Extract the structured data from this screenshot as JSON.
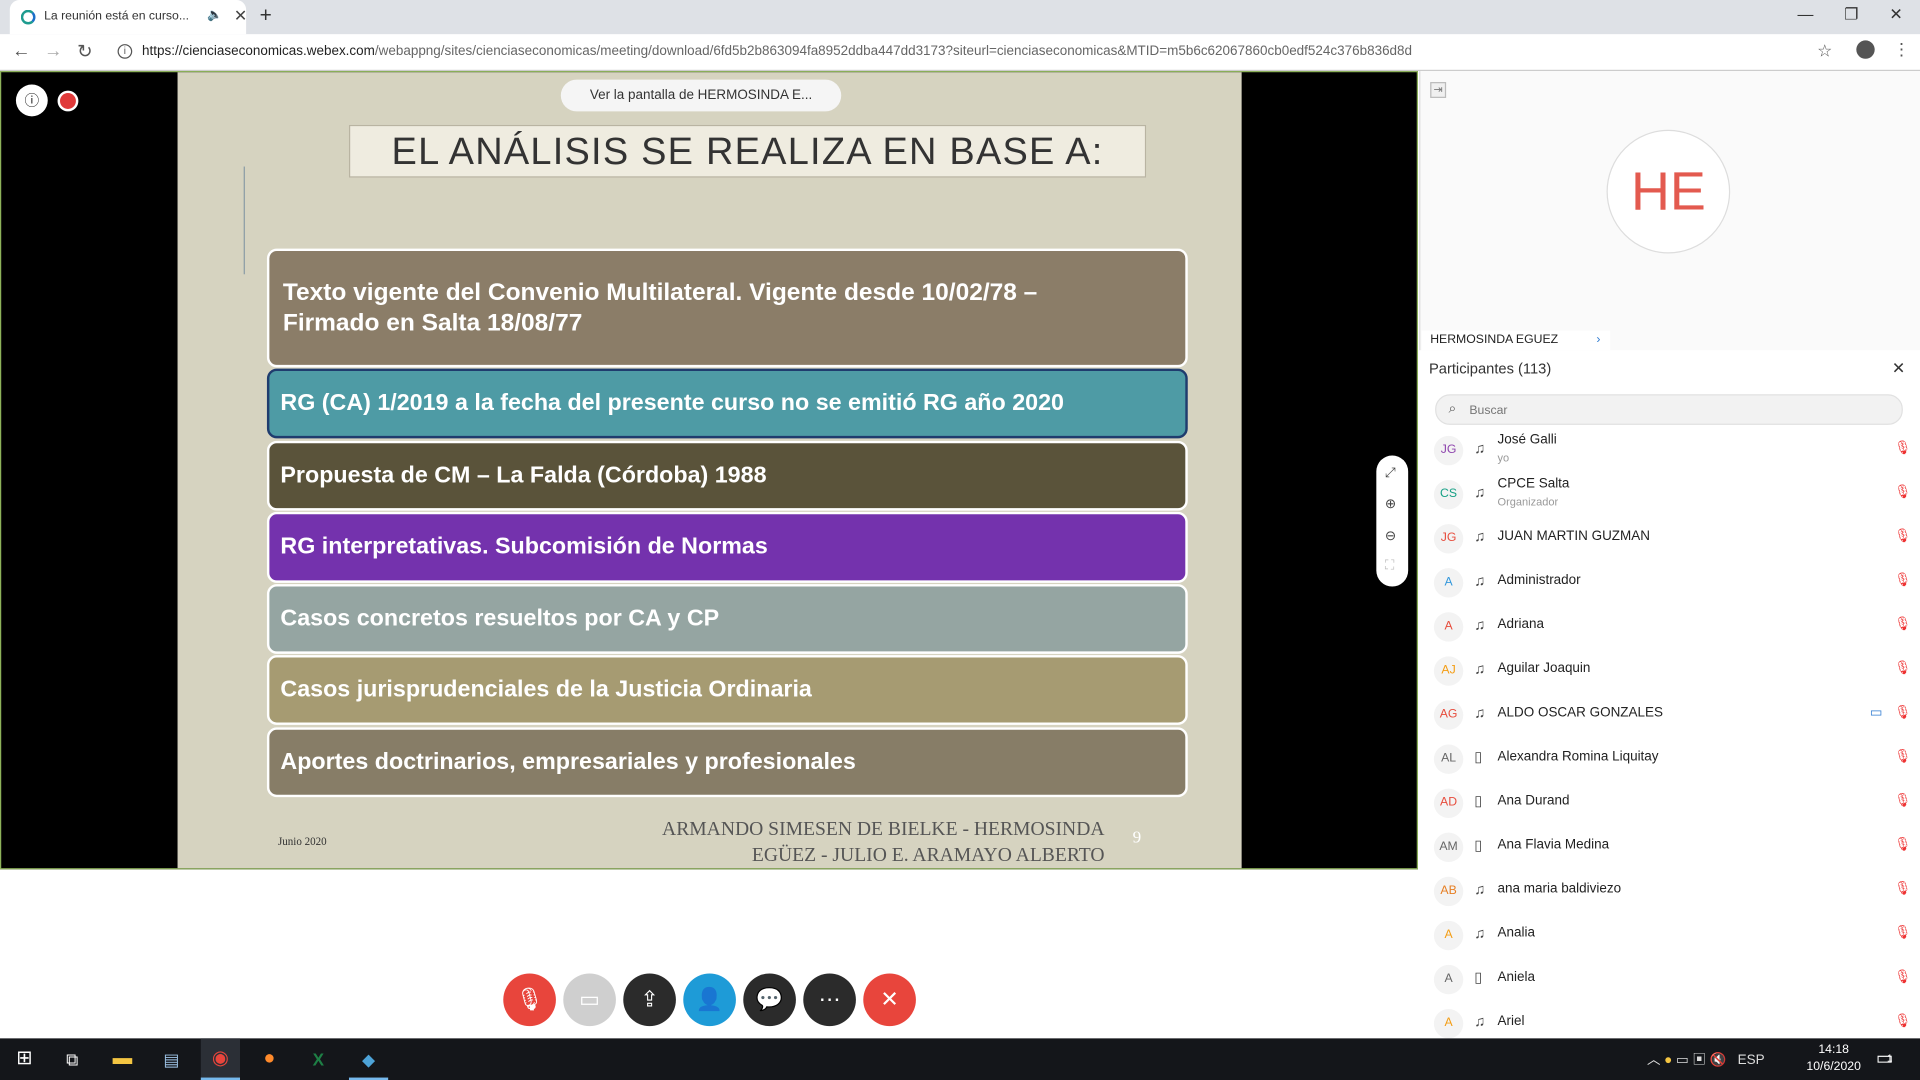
{
  "browser": {
    "tab_title": "La reunión está en curso...",
    "tab_speaker_icon": "speaker-icon",
    "new_tab": "+",
    "url_domain": "https://cienciaseconomicas.webex.com",
    "url_path": "/webappng/sites/cienciaseconomicas/meeting/download/6fd5b2b863094fa8952ddba447dd3173?siteurl=cienciaseconomicas&MTID=m5b6c62067860cb0edf524c376b836d8d"
  },
  "share": {
    "banner": "Ver la pantalla de  HERMOSINDA E..."
  },
  "slide": {
    "title": "EL ANÁLISIS SE REALIZA EN BASE A:",
    "items": [
      "Texto vigente del Convenio Multilateral. Vigente desde 10/02/78 – Firmado en Salta 18/08/77",
      "RG (CA) 1/2019 a la fecha del presente curso no se emitió RG año 2020",
      "Propuesta de CM – La Falda (Córdoba) 1988",
      "RG interpretativas. Subcomisión de Normas",
      "Casos concretos resueltos por CA y CP",
      "Casos jurisprudenciales de la Justicia Ordinaria",
      "Aportes doctrinarios, empresariales y profesionales"
    ],
    "footer_date": "Junio 2020",
    "footer_authors": "ARMANDO SIMESEN DE BIELKE - HERMOSINDA EGÜEZ - JULIO E. ARAMAYO ALBERTO",
    "page_number": "9"
  },
  "video": {
    "avatar_initials": "HE",
    "name": "HERMOSINDA EGUEZ"
  },
  "participants": {
    "header": "Participantes (113)",
    "search_placeholder": "Buscar",
    "list": [
      {
        "initials": "JG",
        "name": "José Galli",
        "role": "yo",
        "device": "headset-icon",
        "color": "#8e44ad"
      },
      {
        "initials": "CS",
        "name": "CPCE Salta",
        "role": "Organizador",
        "device": "headset-icon",
        "color": "#16a085"
      },
      {
        "initials": "JG",
        "name": "JUAN MARTIN GUZMAN",
        "role": "",
        "device": "headset-icon",
        "color": "#e74c3c"
      },
      {
        "initials": "A",
        "name": "Administrador",
        "role": "",
        "device": "headset-icon",
        "color": "#3498db"
      },
      {
        "initials": "A",
        "name": "Adriana",
        "role": "",
        "device": "headset-icon",
        "color": "#e74c3c"
      },
      {
        "initials": "AJ",
        "name": "Aguilar Joaquin",
        "role": "",
        "device": "headset-icon",
        "color": "#f39c12"
      },
      {
        "initials": "AG",
        "name": "ALDO OSCAR GONZALES",
        "role": "",
        "device": "headset-icon",
        "color": "#e74c3c",
        "video": true
      },
      {
        "initials": "AL",
        "name": "Alexandra Romina Liquitay",
        "role": "",
        "device": "phone-icon",
        "color": "#666666"
      },
      {
        "initials": "AD",
        "name": "Ana Durand",
        "role": "",
        "device": "phone-icon",
        "color": "#e74c3c"
      },
      {
        "initials": "AM",
        "name": "Ana Flavia Medina",
        "role": "",
        "device": "phone-icon",
        "color": "#666666"
      },
      {
        "initials": "AB",
        "name": "ana maria baldiviezo",
        "role": "",
        "device": "headset-icon",
        "color": "#e67e22"
      },
      {
        "initials": "A",
        "name": "Analia",
        "role": "",
        "device": "headset-icon",
        "color": "#f39c12"
      },
      {
        "initials": "A",
        "name": "Aniela",
        "role": "",
        "device": "phone-icon",
        "color": "#666666"
      },
      {
        "initials": "A",
        "name": "Ariel",
        "role": "",
        "device": "headset-icon",
        "color": "#f39c12"
      }
    ]
  },
  "controls": [
    {
      "name": "mute-button",
      "icon": "mic-off-icon",
      "color": "#e8453c"
    },
    {
      "name": "video-button",
      "icon": "video-off-icon",
      "color": "#cfcfcf"
    },
    {
      "name": "share-button",
      "icon": "share-icon",
      "color": "#2b2b2b"
    },
    {
      "name": "participants-button",
      "icon": "participants-icon",
      "color": "#1e9bd7"
    },
    {
      "name": "chat-button",
      "icon": "chat-icon",
      "color": "#2b2b2b"
    },
    {
      "name": "more-button",
      "icon": "more-icon",
      "color": "#2b2b2b"
    },
    {
      "name": "leave-button",
      "icon": "close-icon",
      "color": "#e8453c"
    }
  ],
  "taskbar": {
    "lang": "ESP",
    "time": "14:18",
    "date": "10/6/2020",
    "notif_count": "1"
  }
}
